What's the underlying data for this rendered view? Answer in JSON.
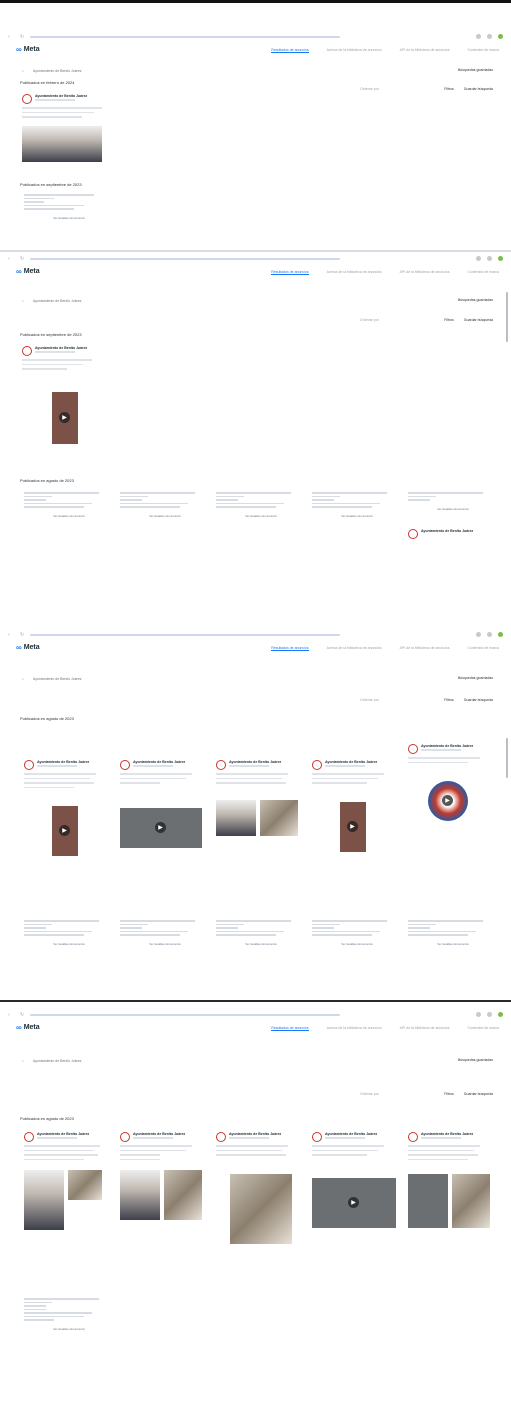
{
  "app": {
    "brand": "Meta",
    "tabs": [
      "Resultados de anuncios",
      "Acerca de la biblioteca de anuncios",
      "API de la biblioteca de anuncios",
      "Contenido de marca"
    ],
    "search_query": "Ayuntamiento de Benito Juárez",
    "filter_label": "Filtros",
    "save_search_label": "Guardar búsqueda",
    "saved_searches_label": "Búsquedas guardadas",
    "sort_label": "Ordenar por"
  },
  "section_titles": {
    "feb_2024": "Publicados en febrero de 2024",
    "sep_2023": "Publicados en septiembre de 2023",
    "aug_2023": "Publicados en agosto de 2023"
  },
  "advertiser": {
    "name": "Ayuntamiento de Benito Juárez"
  },
  "detail_link": "Ver detalles del anuncio",
  "colors": {
    "accent": "#1877f2",
    "avatar_ring": "#c8352f",
    "text": "#1c2b33"
  },
  "icons": [
    "search-icon",
    "play-icon",
    "filter-icon",
    "bookmark-icon",
    "chevron-down-icon"
  ]
}
